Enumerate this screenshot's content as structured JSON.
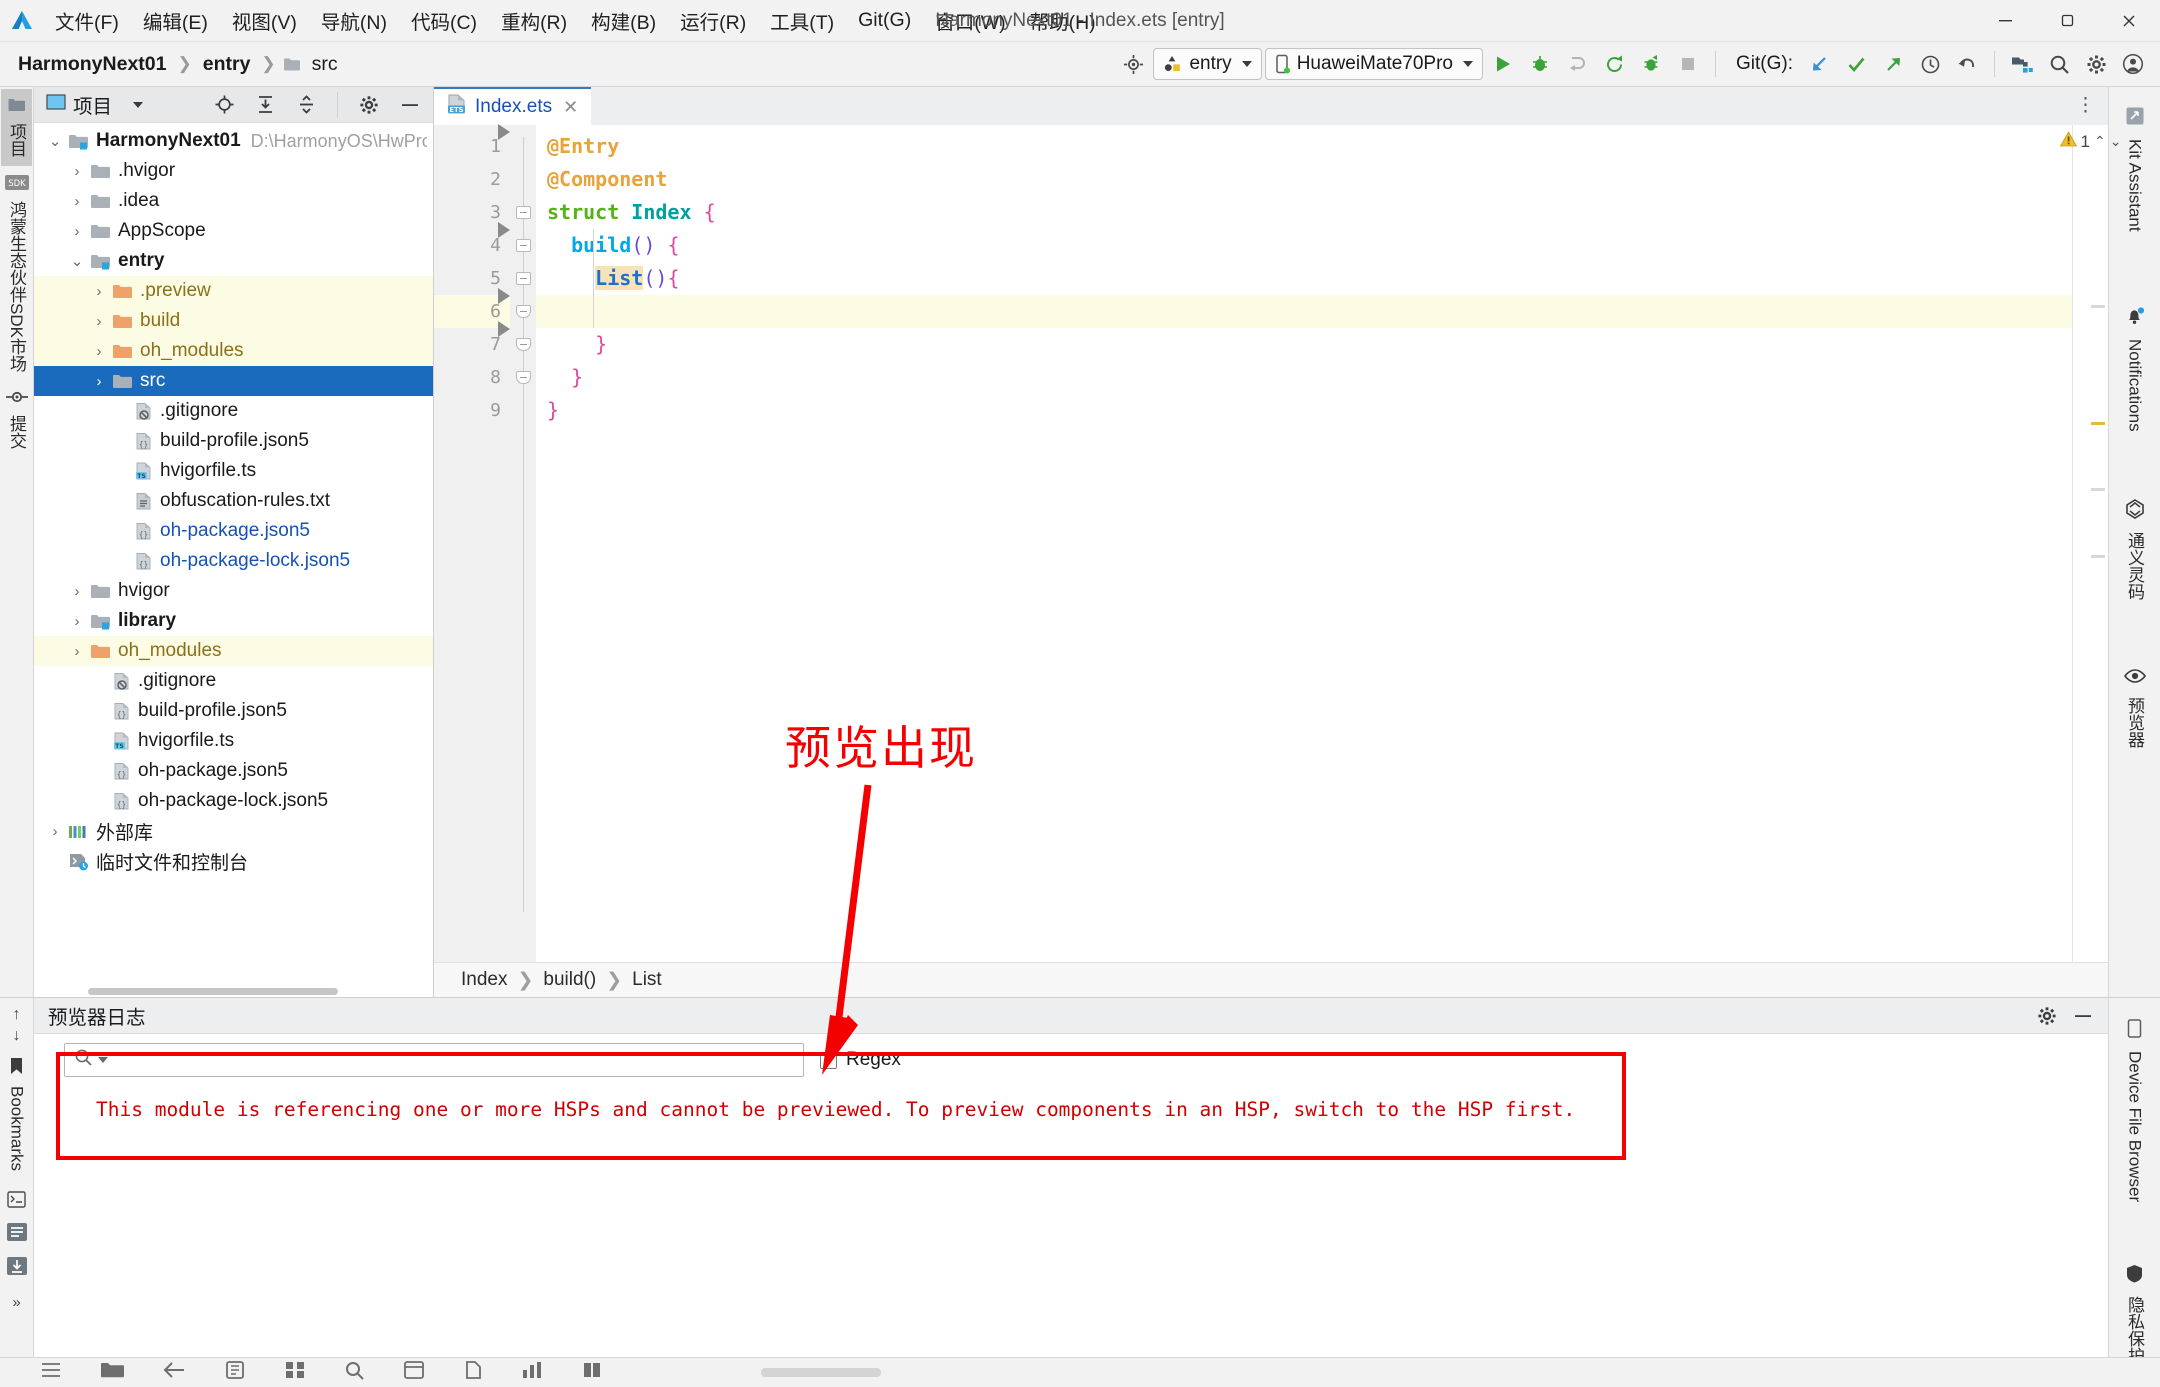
{
  "window": {
    "title": "HarmonyNext01 - Index.ets [entry]",
    "minimize": "–",
    "restore": "❐",
    "close": "✕"
  },
  "menu": {
    "items": [
      {
        "label": "文件(F)",
        "name": "menu-file"
      },
      {
        "label": "编辑(E)",
        "name": "menu-edit"
      },
      {
        "label": "视图(V)",
        "name": "menu-view"
      },
      {
        "label": "导航(N)",
        "name": "menu-navigate"
      },
      {
        "label": "代码(C)",
        "name": "menu-code"
      },
      {
        "label": "重构(R)",
        "name": "menu-refactor"
      },
      {
        "label": "构建(B)",
        "name": "menu-build"
      },
      {
        "label": "运行(R)",
        "name": "menu-run"
      },
      {
        "label": "工具(T)",
        "name": "menu-tools"
      },
      {
        "label": "Git(G)",
        "name": "menu-git"
      },
      {
        "label": "窗口(W)",
        "name": "menu-window"
      },
      {
        "label": "帮助(H)",
        "name": "menu-help"
      }
    ]
  },
  "navbar": {
    "crumb_project": "HarmonyNext01",
    "crumb_module": "entry",
    "crumb_folder": "src",
    "run_config": "entry",
    "device": "HuaweiMate70Pro",
    "git_label": "Git(G):"
  },
  "stripe_left": {
    "project": "项目",
    "sdk_market": "鸿蒙生态伙伴SDK市场",
    "commit": "提交"
  },
  "stripe_right": {
    "kit_assistant": "Kit Assistant",
    "notifications": "Notifications",
    "tongyi": "通义灵码",
    "previewer": "预览器"
  },
  "stripe_bottom_left": {
    "bookmarks": "Bookmarks",
    "structure": "结构"
  },
  "stripe_bottom_right": {
    "device_file_browser": "Device File Browser",
    "security": "隐私保护"
  },
  "project_panel": {
    "title": "项目",
    "tree": [
      {
        "depth": 0,
        "arrow": "v",
        "label": "HarmonyNext01",
        "bold": true,
        "icon": "module-folder-icon",
        "path": "D:\\HarmonyOS\\HwPro",
        "style": "normal",
        "name": "tree-item-harmonynext01"
      },
      {
        "depth": 1,
        "arrow": ">",
        "label": ".hvigor",
        "bold": false,
        "icon": "folder-icon",
        "path": "",
        "style": "normal",
        "name": "tree-item-hvigor-hidden"
      },
      {
        "depth": 1,
        "arrow": ">",
        "label": ".idea",
        "bold": false,
        "icon": "folder-icon",
        "path": "",
        "style": "normal",
        "name": "tree-item-idea"
      },
      {
        "depth": 1,
        "arrow": ">",
        "label": "AppScope",
        "bold": false,
        "icon": "folder-icon",
        "path": "",
        "style": "normal",
        "name": "tree-item-appscope"
      },
      {
        "depth": 1,
        "arrow": "v",
        "label": "entry",
        "bold": true,
        "icon": "module-folder-icon",
        "path": "",
        "style": "normal",
        "name": "tree-item-entry"
      },
      {
        "depth": 2,
        "arrow": ">",
        "label": ".preview",
        "bold": false,
        "icon": "orange-folder-icon",
        "path": "",
        "style": "yellow",
        "name": "tree-item-preview"
      },
      {
        "depth": 2,
        "arrow": ">",
        "label": "build",
        "bold": false,
        "icon": "orange-folder-icon",
        "path": "",
        "style": "yellow",
        "name": "tree-item-build"
      },
      {
        "depth": 2,
        "arrow": ">",
        "label": "oh_modules",
        "bold": false,
        "icon": "orange-folder-icon",
        "path": "",
        "style": "yellow",
        "name": "tree-item-oh-modules-entry"
      },
      {
        "depth": 2,
        "arrow": ">",
        "label": "src",
        "bold": false,
        "icon": "folder-icon",
        "path": "",
        "style": "selected",
        "name": "tree-item-src"
      },
      {
        "depth": 3,
        "arrow": "",
        "label": ".gitignore",
        "bold": false,
        "icon": "gitignore-file-icon",
        "path": "",
        "style": "normal",
        "name": "tree-item-gitignore-entry"
      },
      {
        "depth": 3,
        "arrow": "",
        "label": "build-profile.json5",
        "bold": false,
        "icon": "json-file-icon",
        "path": "",
        "style": "normal",
        "name": "tree-item-build-profile-entry"
      },
      {
        "depth": 3,
        "arrow": "",
        "label": "hvigorfile.ts",
        "bold": false,
        "icon": "ts-file-icon",
        "path": "",
        "style": "normal",
        "name": "tree-item-hvigorfile-entry"
      },
      {
        "depth": 3,
        "arrow": "",
        "label": "obfuscation-rules.txt",
        "bold": false,
        "icon": "text-file-icon",
        "path": "",
        "style": "normal",
        "name": "tree-item-obfuscation-rules"
      },
      {
        "depth": 3,
        "arrow": "",
        "label": "oh-package.json5",
        "bold": false,
        "icon": "json-file-icon",
        "path": "",
        "style": "link",
        "name": "tree-item-oh-package-entry"
      },
      {
        "depth": 3,
        "arrow": "",
        "label": "oh-package-lock.json5",
        "bold": false,
        "icon": "json-file-icon",
        "path": "",
        "style": "link",
        "name": "tree-item-oh-package-lock-entry"
      },
      {
        "depth": 1,
        "arrow": ">",
        "label": "hvigor",
        "bold": false,
        "icon": "folder-icon",
        "path": "",
        "style": "normal",
        "name": "tree-item-hvigor"
      },
      {
        "depth": 1,
        "arrow": ">",
        "label": "library",
        "bold": true,
        "icon": "module-folder-icon",
        "path": "",
        "style": "normal",
        "name": "tree-item-library"
      },
      {
        "depth": 1,
        "arrow": ">",
        "label": "oh_modules",
        "bold": false,
        "icon": "orange-folder-icon",
        "path": "",
        "style": "yellow",
        "name": "tree-item-oh-modules-root"
      },
      {
        "depth": 2,
        "arrow": "",
        "label": ".gitignore",
        "bold": false,
        "icon": "gitignore-file-icon",
        "path": "",
        "style": "normal",
        "name": "tree-item-gitignore-root"
      },
      {
        "depth": 2,
        "arrow": "",
        "label": "build-profile.json5",
        "bold": false,
        "icon": "json-file-icon",
        "path": "",
        "style": "normal",
        "name": "tree-item-build-profile-root"
      },
      {
        "depth": 2,
        "arrow": "",
        "label": "hvigorfile.ts",
        "bold": false,
        "icon": "ts-file-icon",
        "path": "",
        "style": "normal",
        "name": "tree-item-hvigorfile-root"
      },
      {
        "depth": 2,
        "arrow": "",
        "label": "oh-package.json5",
        "bold": false,
        "icon": "json-file-icon",
        "path": "",
        "style": "normal",
        "name": "tree-item-oh-package-root"
      },
      {
        "depth": 2,
        "arrow": "",
        "label": "oh-package-lock.json5",
        "bold": false,
        "icon": "json-file-icon",
        "path": "",
        "style": "normal",
        "name": "tree-item-oh-package-lock-root"
      },
      {
        "depth": 0,
        "arrow": ">",
        "label": "外部库",
        "bold": false,
        "icon": "library-bars-icon",
        "path": "",
        "style": "normal",
        "name": "tree-item-external-libraries"
      },
      {
        "depth": 0,
        "arrow": "",
        "label": "临时文件和控制台",
        "bold": false,
        "icon": "scratches-icon",
        "path": "",
        "style": "normal",
        "name": "tree-item-scratches"
      }
    ]
  },
  "editor": {
    "tab_label": "Index.ets",
    "tab_close": "✕",
    "warning_count": "1",
    "lines": [
      {
        "n": "1",
        "text": "@Entry"
      },
      {
        "n": "2",
        "text": "@Component"
      },
      {
        "n": "3",
        "text": "struct Index {"
      },
      {
        "n": "4",
        "text": "  build() {"
      },
      {
        "n": "5",
        "text": "    List(){"
      },
      {
        "n": "6",
        "text": ""
      },
      {
        "n": "7",
        "text": "    }"
      },
      {
        "n": "8",
        "text": "  }"
      },
      {
        "n": "9",
        "text": "}"
      }
    ],
    "breadcrumbs": [
      "Index",
      "build()",
      "List"
    ]
  },
  "bottom_panel": {
    "title": "预览器日志",
    "search_placeholder": "",
    "search_value": "",
    "regex_label": "Regex",
    "log_message": "This module is referencing one or more HSPs and cannot be previewed. To preview components in an HSP, switch to the HSP first."
  },
  "annotation": {
    "text": "预览出现",
    "color": "#f50000"
  },
  "colors": {
    "accent_blue": "#1a6bbd",
    "selection_yellow": "#fcfbe3",
    "error_red": "#d00000",
    "annotation_red": "#f50000",
    "link_blue": "#1552b5"
  }
}
